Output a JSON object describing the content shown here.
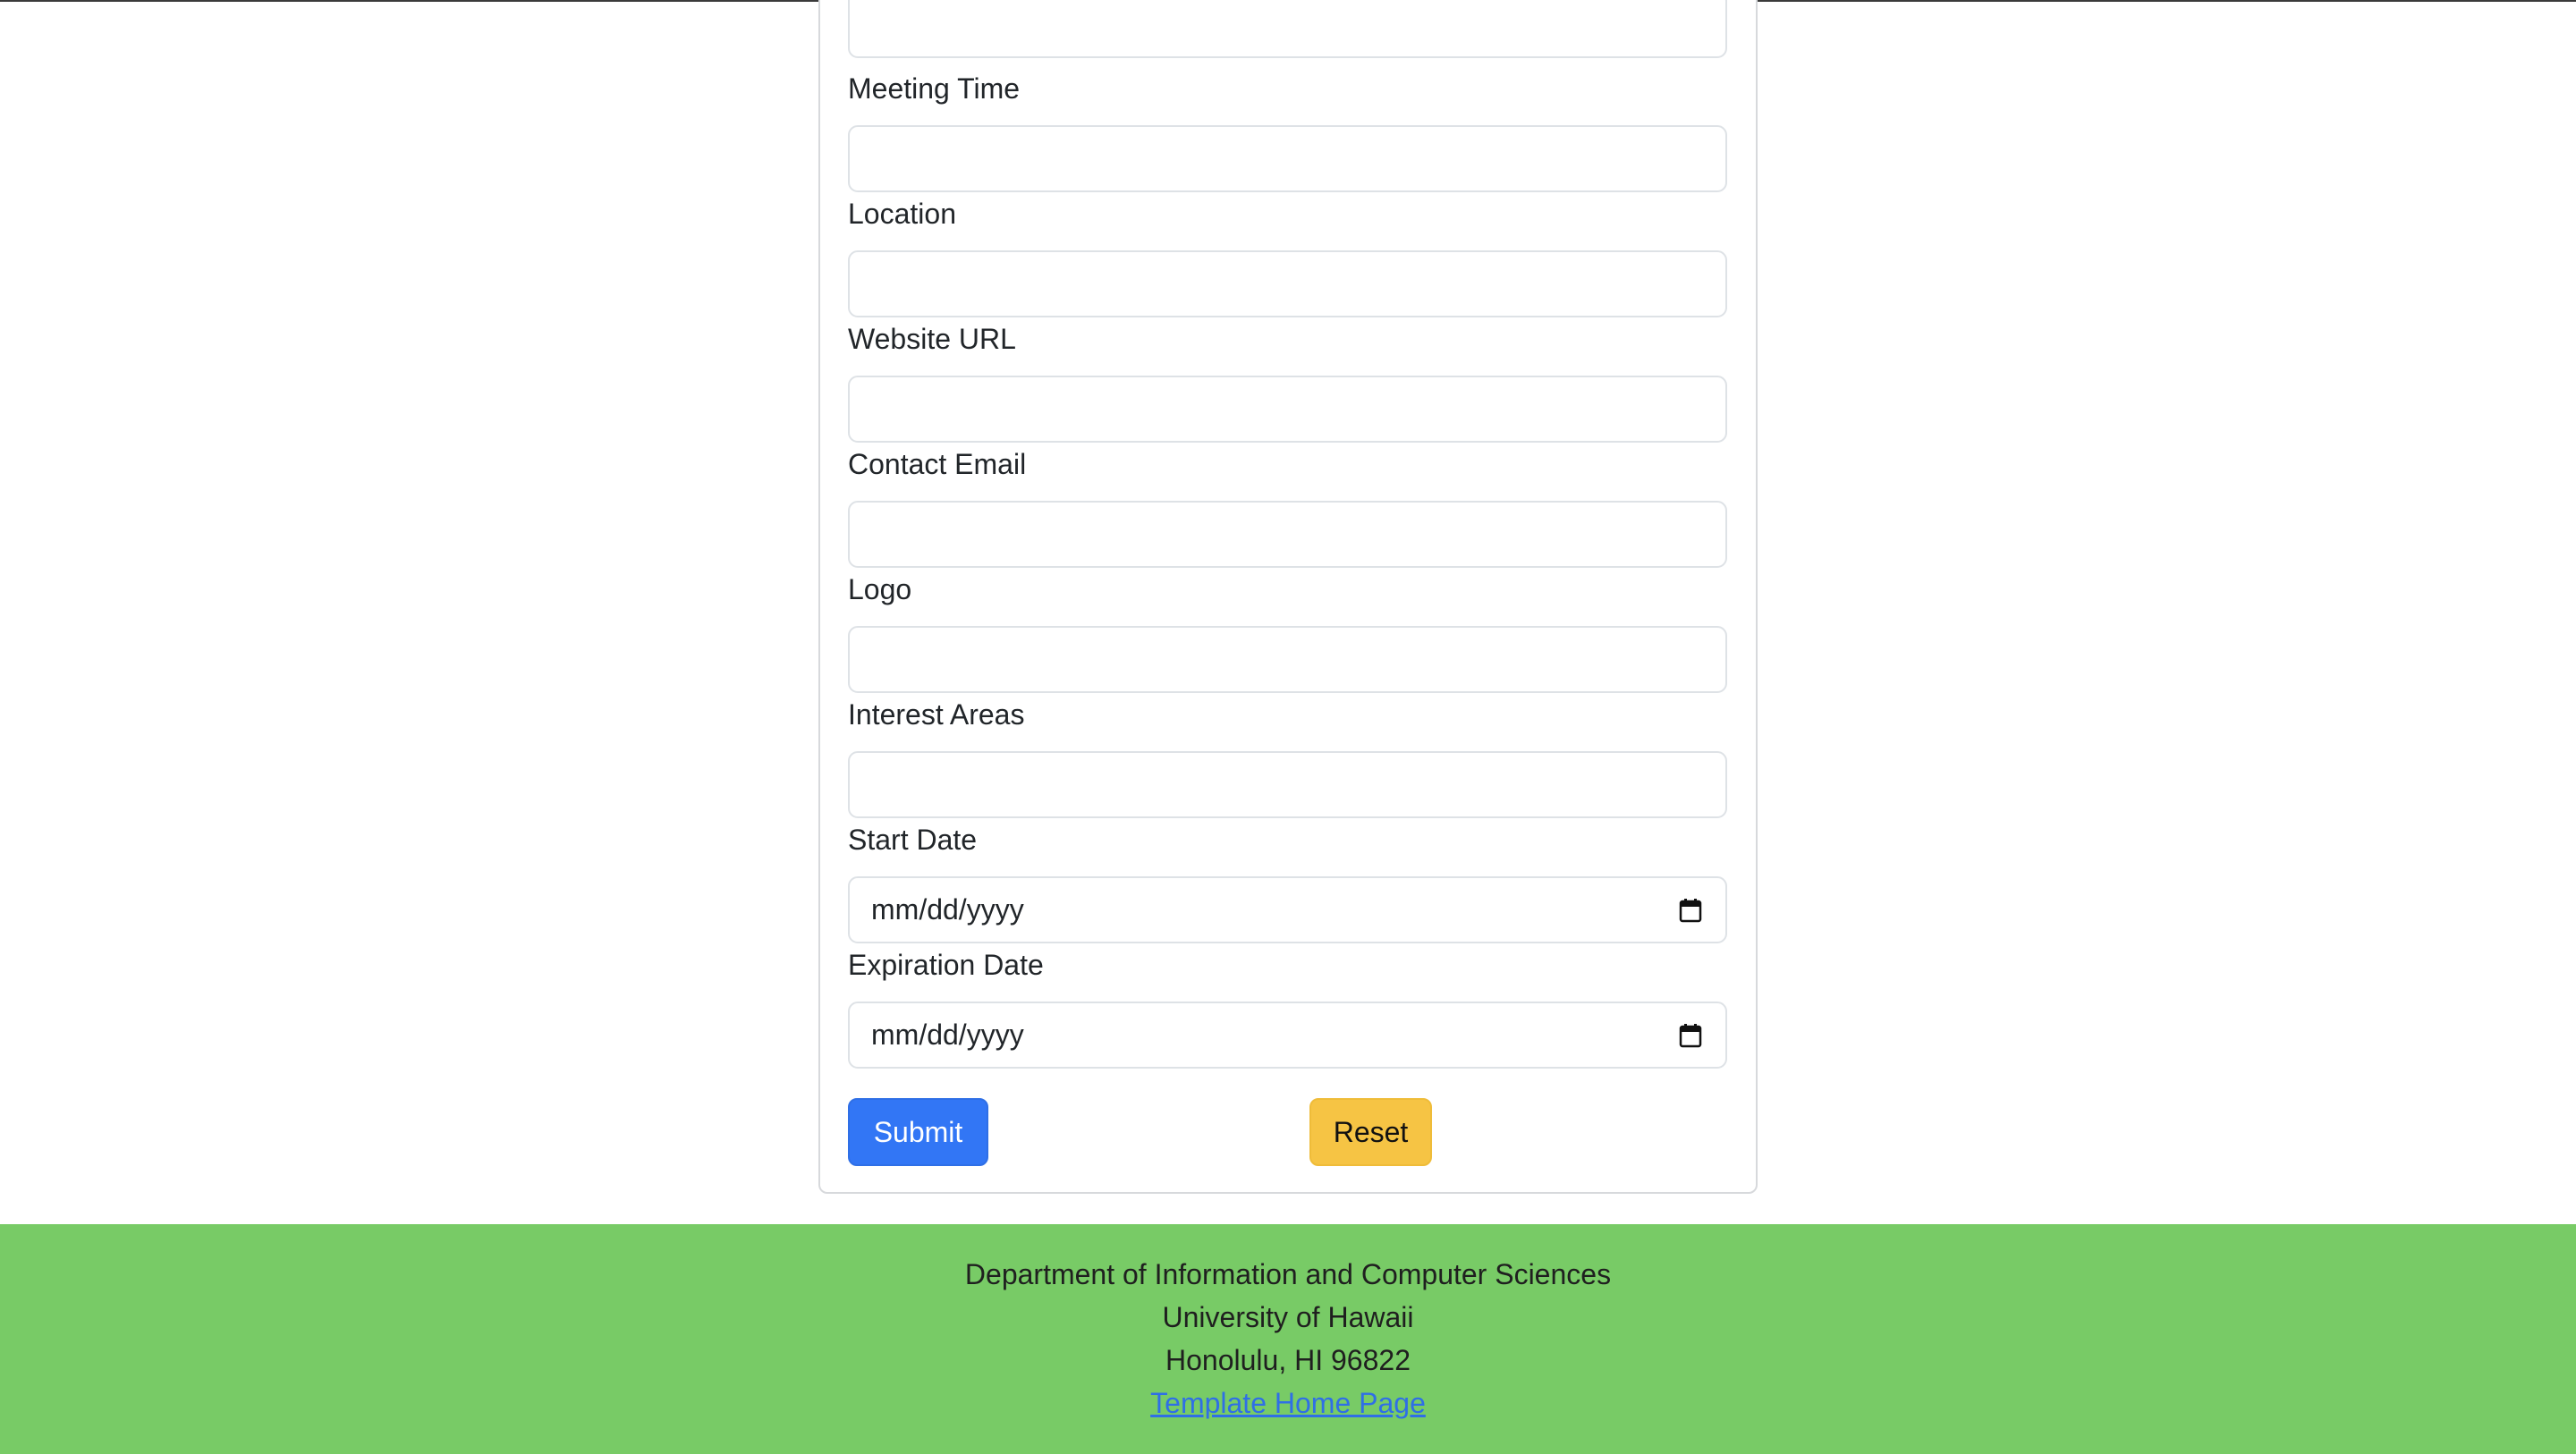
{
  "form": {
    "fields": [
      {
        "label": "Meeting Time",
        "value": "",
        "type": "text"
      },
      {
        "label": "Location",
        "value": "",
        "type": "text"
      },
      {
        "label": "Website URL",
        "value": "",
        "type": "text"
      },
      {
        "label": "Contact Email",
        "value": "",
        "type": "text"
      },
      {
        "label": "Logo",
        "value": "",
        "type": "text"
      },
      {
        "label": "Interest Areas",
        "value": "",
        "type": "text"
      },
      {
        "label": "Start Date",
        "placeholder": "mm/dd/yyyy",
        "type": "date"
      },
      {
        "label": "Expiration Date",
        "placeholder": "mm/dd/yyyy",
        "type": "date"
      }
    ],
    "submit_label": "Submit",
    "reset_label": "Reset"
  },
  "footer": {
    "line1": "Department of Information and Computer Sciences",
    "line2": "University of Hawaii",
    "line3": "Honolulu, HI 96822",
    "link_label": "Template Home Page"
  },
  "colors": {
    "submit_bg": "#3276f5",
    "reset_bg": "#f6c444",
    "footer_bg": "#78cb66",
    "link": "#2f6fe6"
  },
  "icons": {
    "date_picker": "calendar-icon"
  }
}
